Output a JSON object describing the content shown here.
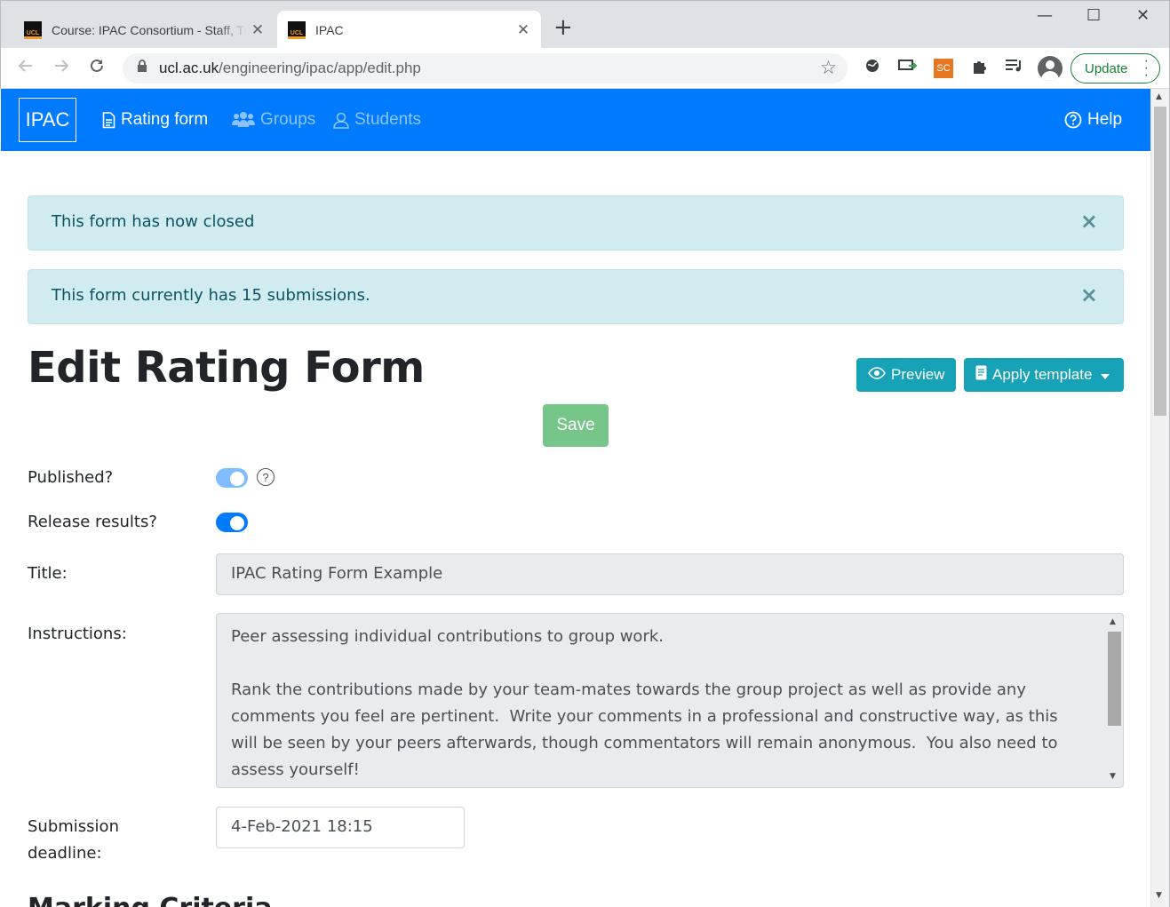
{
  "browser": {
    "tabs": [
      {
        "title": "Course: IPAC Consortium - Staff, Tutors",
        "active": false
      },
      {
        "title": "IPAC",
        "active": true
      }
    ],
    "favicon_text": "UCL",
    "url_host": "ucl.ac.uk",
    "url_path": "/engineering/ipac/app/edit.php",
    "update_label": "Update",
    "extension_sc_label": "SC"
  },
  "navbar": {
    "brand": "IPAC",
    "items": [
      {
        "label": "Rating form",
        "icon": "document-icon",
        "active": true
      },
      {
        "label": "Groups",
        "icon": "users-icon",
        "active": false
      },
      {
        "label": "Students",
        "icon": "user-icon",
        "active": false
      }
    ],
    "help_label": "Help"
  },
  "alerts": [
    {
      "text": "This form has now closed"
    },
    {
      "text": "This form currently has 15 submissions."
    }
  ],
  "page": {
    "title": "Edit Rating Form",
    "preview_label": "Preview",
    "apply_template_label": "Apply template",
    "save_label": "Save"
  },
  "form": {
    "published_label": "Published?",
    "published_on": true,
    "release_label": "Release results?",
    "release_on": true,
    "title_label": "Title:",
    "title_value": "IPAC Rating Form Example",
    "instructions_label": "Instructions:",
    "instructions_value": "Peer assessing individual contributions to group work.\n\nRank the contributions made by your team-mates towards the group project as well as provide any comments you feel are pertinent.  Write your comments in a professional and constructive way, as this will be seen by your peers afterwards, though commentators will remain anonymous.  You also need to assess yourself!",
    "deadline_label": "Submission deadline:",
    "deadline_value": "4-Feb-2021 18:15",
    "next_section_heading": "Marking Criteria"
  },
  "colors": {
    "primary": "#007bff",
    "info": "#17a2b8",
    "success_disabled": "#76c68a",
    "alert_bg": "#d1ecf1",
    "alert_text": "#0c5460"
  }
}
